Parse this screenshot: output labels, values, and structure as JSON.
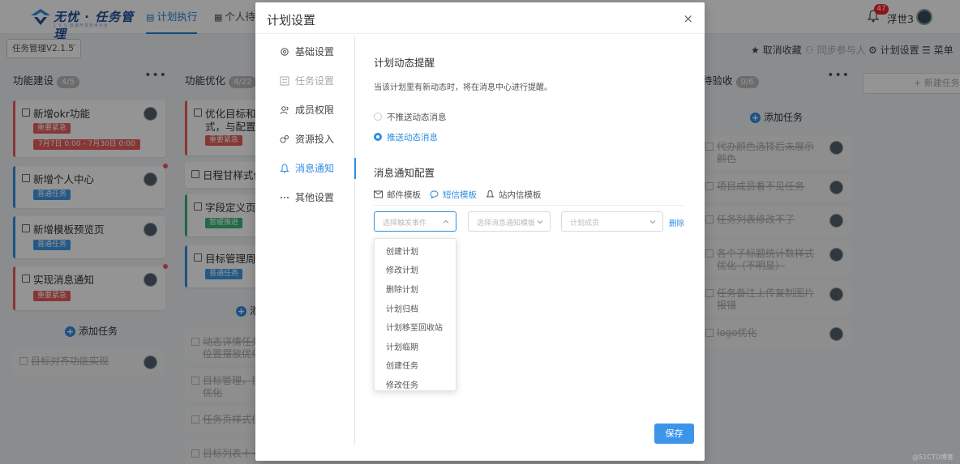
{
  "app": {
    "logo_text": "无忧 · 任务管理",
    "logo_sub": "J V S 快速开发技术平台",
    "nav_tabs": [
      "计划执行",
      "个人待办"
    ],
    "notification_count": "47",
    "username": "浮世3"
  },
  "toolbar": {
    "project": "任务管理V2.1.5",
    "actions": [
      "取消收藏",
      "同步参与人",
      "计划设置",
      "菜单"
    ]
  },
  "board": {
    "columns": [
      {
        "title": "功能建设",
        "count": "4/5",
        "cards": [
          {
            "title": "新增okr功能",
            "tag": "重要紧急",
            "date": "7月7日 0:00 - 7月30日 0:00"
          },
          {
            "title": "新增个人中心",
            "tag": "普通任务"
          },
          {
            "title": "新增模板预览页",
            "tag": "普通任务"
          },
          {
            "title": "实现消息通知",
            "tag": "重要紧急"
          }
        ],
        "add_label": "添加任务",
        "done": [
          "目标对齐功能实现"
        ]
      },
      {
        "title": "功能优化",
        "count": "4/22",
        "cards": [
          {
            "title": "优化目标和模",
            "title2": "式，与配置中",
            "tag": "重要紧急"
          },
          {
            "title": "日程甘样式优"
          },
          {
            "title": "字段定义页面",
            "tag": "暂缓推进"
          },
          {
            "title": "目标管理周期",
            "tag": "普通任务"
          }
        ],
        "add_label": "添",
        "done": [
          "动态详情任务",
          "位置摆放优化",
          "目标管理，目",
          "优化",
          "任务页样式优",
          "目标列表十一"
        ]
      },
      {
        "title": "待验收",
        "count": "0/6",
        "add_label": "添加任务",
        "done": [
          "代办颜色选择后未展示颜色",
          "项目成员看不见任务",
          "任务列表修改不了",
          "各个子标题统计数样式优化（不明显）",
          "任务备注上传复制图片报错",
          "logo优化"
        ]
      }
    ],
    "new_column": "+ 新建任务"
  },
  "modal": {
    "title": "计划设置",
    "close": "×",
    "nav": [
      "基础设置",
      "任务设置",
      "成员权限",
      "资源投入",
      "消息通知",
      "其他设置"
    ],
    "active_nav": "消息通知",
    "section1_title": "计划动态提醒",
    "section1_desc": "当该计划里有新动态时，将在消息中心进行提醒。",
    "radio_off": "不推送动态消息",
    "radio_on": "推送动态消息",
    "section2_title": "消息通知配置",
    "template_tabs": [
      "邮件模板",
      "短信模板",
      "站内信模板"
    ],
    "select_event_placeholder": "选择触发事件",
    "select_template_placeholder": "选择消息通知模板",
    "select_member_placeholder": "计划成员",
    "delete_label": "删除",
    "dropdown_options": [
      "创建计划",
      "修改计划",
      "删除计划",
      "计划归档",
      "计划移至回收站",
      "计划临期",
      "创建任务",
      "修改任务"
    ],
    "save_label": "保存"
  },
  "watermark": "@51CTO博客",
  "colors": {
    "accent": "#2f8de4",
    "urgent": "#e85d5d",
    "normal": "#3d9ae8",
    "paused": "#3cb878"
  }
}
